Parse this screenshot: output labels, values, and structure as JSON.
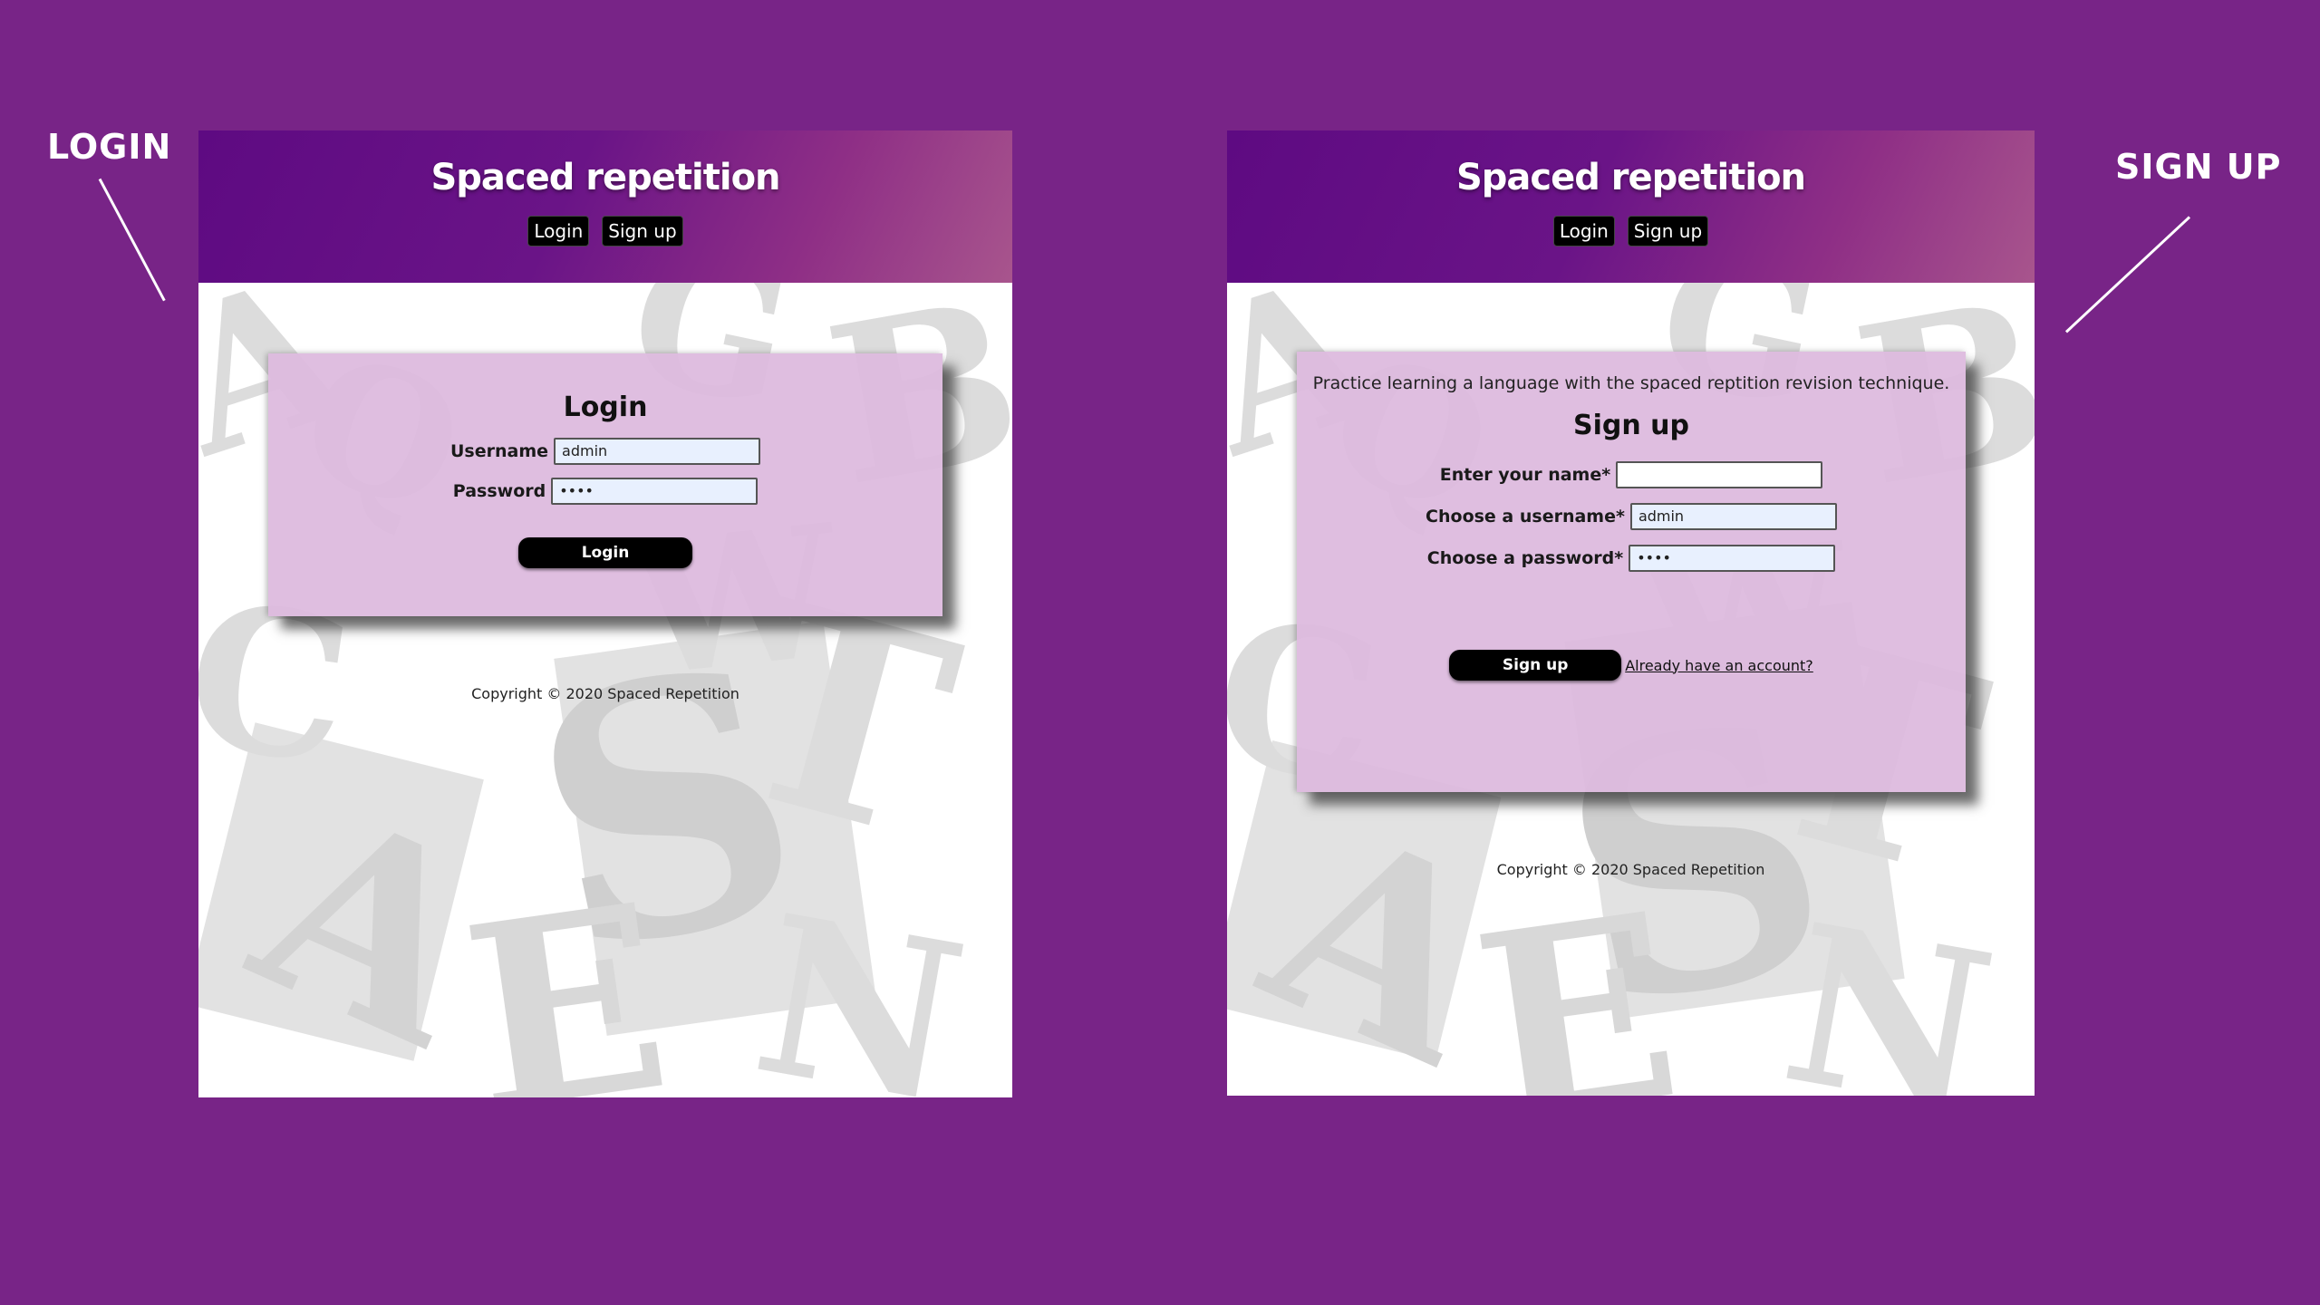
{
  "callouts": {
    "login": "LOGIN",
    "signup": "SIGN UP"
  },
  "site": {
    "title": "Spaced repetition",
    "nav": {
      "login": "Login",
      "signup": "Sign up"
    },
    "copyright": "Copyright © 2020 Spaced Repetition"
  },
  "login_panel": {
    "heading": "Login",
    "username_label": "Username",
    "username_value": "admin",
    "password_label": "Password",
    "password_value": "••••",
    "submit_label": "Login"
  },
  "signup_panel": {
    "intro": "Practice learning a language with the spaced reptition revision technique.",
    "heading": "Sign up",
    "name_label": "Enter your name*",
    "name_value": "",
    "username_label": "Choose a username*",
    "username_value": "admin",
    "password_label": "Choose a password*",
    "password_value": "••••",
    "submit_label": "Sign up",
    "login_link": "Already have an account?"
  },
  "colors": {
    "page_background": "#782487",
    "header_start": "#5e0a82",
    "header_end": "#a8558d",
    "card_background": "#ddb9de",
    "button": "#000000"
  }
}
